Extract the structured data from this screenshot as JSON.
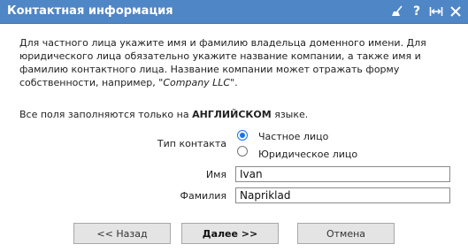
{
  "window": {
    "title": "Контактная информация",
    "icons": [
      "broom-icon",
      "help-icon",
      "resize-icon",
      "close-icon"
    ],
    "help_glyph": "?"
  },
  "description": {
    "text_before": "Для частного лица укажите имя и фамилию владельца доменного имени. Для юридического лица обязательно укажите название компании, а также имя и фамилию контактного лица. Название компании может отражать форму собственности, например, \"",
    "example": "Company LLC",
    "text_after": "\"."
  },
  "note": {
    "before": "Все поля заполняются только на ",
    "bold": "АНГЛИЙСКОМ",
    "after": " языке."
  },
  "contact_type": {
    "label": "Тип контакта",
    "options": [
      {
        "label": "Частное лицо",
        "checked": true
      },
      {
        "label": "Юридическое лицо",
        "checked": false
      }
    ]
  },
  "fields": {
    "first_name": {
      "label": "Имя",
      "value": "Ivan"
    },
    "last_name": {
      "label": "Фамилия",
      "value": "Napriklad"
    }
  },
  "buttons": {
    "back": "<< Назад",
    "next": "Далее >>",
    "cancel": "Отмена"
  },
  "colors": {
    "titlebar": "#4f86c6",
    "radio_accent": "#1a73e8",
    "button_bg": "#e4e4e4"
  }
}
